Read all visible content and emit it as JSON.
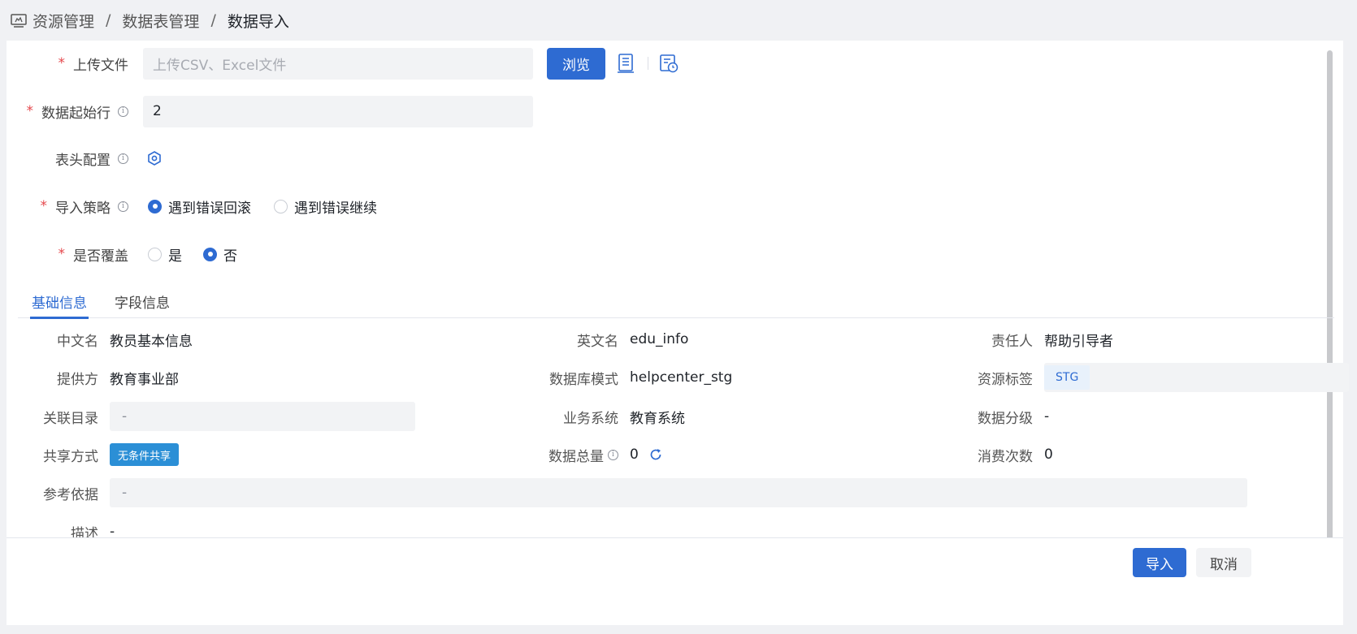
{
  "breadcrumb": {
    "items": [
      "资源管理",
      "数据表管理",
      "数据导入"
    ],
    "separator": "/"
  },
  "form": {
    "upload": {
      "label": "上传文件",
      "placeholder": "上传CSV、Excel文件",
      "browse": "浏览"
    },
    "start_row": {
      "label": "数据起始行",
      "value": "2"
    },
    "header_config": {
      "label": "表头配置"
    },
    "strategy": {
      "label": "导入策略",
      "options": [
        "遇到错误回滚",
        "遇到错误继续"
      ],
      "selected": "遇到错误回滚"
    },
    "overwrite": {
      "label": "是否覆盖",
      "options": [
        "是",
        "否"
      ],
      "selected": "否"
    }
  },
  "tabs": [
    "基础信息",
    "字段信息"
  ],
  "basic": {
    "cn_name": {
      "label": "中文名",
      "value": "教员基本信息"
    },
    "en_name": {
      "label": "英文名",
      "value": "edu_info"
    },
    "owner": {
      "label": "责任人",
      "value": "帮助引导者"
    },
    "provider": {
      "label": "提供方",
      "value": "教育事业部"
    },
    "schema": {
      "label": "数据库模式",
      "value": "helpcenter_stg"
    },
    "tags": {
      "label": "资源标签",
      "value": "STG"
    },
    "catalog": {
      "label": "关联目录",
      "value": "-"
    },
    "biz_system": {
      "label": "业务系统",
      "value": "教育系统"
    },
    "grade": {
      "label": "数据分级",
      "value": "-"
    },
    "share": {
      "label": "共享方式",
      "value": "无条件共享"
    },
    "total": {
      "label": "数据总量",
      "value": "0"
    },
    "consume": {
      "label": "消费次数",
      "value": "0"
    },
    "reference": {
      "label": "参考依据",
      "value": "-"
    },
    "desc": {
      "label": "描述",
      "value": "-"
    }
  },
  "footer": {
    "import": "导入",
    "cancel": "取消"
  },
  "colors": {
    "primary": "#2e6bd2",
    "required": "#e5484d",
    "badge": "#2b8fd6"
  }
}
